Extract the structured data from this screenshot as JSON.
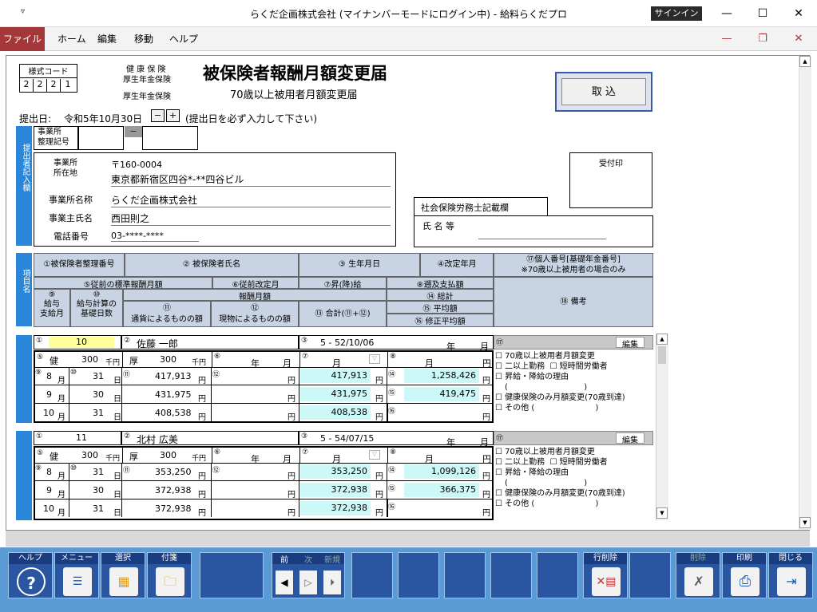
{
  "window": {
    "title": "らくだ企画株式会社 (マイナンバーモードにログイン中) - 給料らくだプロ",
    "signin": "サインイン",
    "min": "—",
    "max": "☐",
    "close": "✕"
  },
  "menu": {
    "file": "ファイル",
    "home": "ホーム",
    "edit": "編集",
    "move": "移動",
    "help": "ヘルプ",
    "mdi_min": "—",
    "mdi_restore": "❐",
    "mdi_close": "✕"
  },
  "form": {
    "code_label": "様式コード",
    "code_digits": [
      "2",
      "2",
      "2",
      "1"
    ],
    "ins1": "健 康 保 険",
    "ins2": "厚生年金保険",
    "ins3": "厚生年金保険",
    "title": "被保険者報酬月額変更届",
    "subtitle": "70歳以上被用者月額変更届",
    "import_btn": "取 込",
    "submit_label": "提出日:",
    "submit_date": "令和5年10月30日",
    "minus": "−",
    "plus": "+",
    "submit_note": "(提出日を必ず入力して下さい)",
    "office_no_label": "事業所\n整理記号",
    "office_no_dash": "−",
    "side_label": "提出者記入欄",
    "addr_label": "事業所\n所在地",
    "postal": "〒160-0004",
    "address": "東京都新宿区四谷*-**四谷ビル",
    "name_label": "事業所名称",
    "company": "らくだ企画株式会社",
    "owner_label": "事業主氏名",
    "owner": "西田則之",
    "tel_label": "電話番号",
    "tel": "03-****-****",
    "stamp_label": "受付印",
    "sharoshi_label": "社会保険労務士記載欄",
    "sharoshi_name_label": "氏 名 等"
  },
  "headers": {
    "side": "項目名",
    "h1": "①被保険者整理番号",
    "h2": "② 被保険者氏名",
    "h3": "③ 生年月日",
    "h4": "④改定年月",
    "h17": "⑰個人番号[基礎年金番号]\n※70歳以上被用者の場合のみ",
    "h5": "⑤従前の標準報酬月額",
    "h6": "⑥従前改定月",
    "h7": "⑦昇(降)給",
    "h8": "⑧遡及支払額",
    "h_pay": "報酬月額",
    "h14": "⑭ 総計",
    "h9": "⑨\n給与\n支給月",
    "h10": "⑩\n給与計算の\n基礎日数",
    "h11": "⑪\n通貨によるものの額",
    "h12": "⑫\n現物によるものの額",
    "h13": "⑬ 合計(⑪+⑫)",
    "h15": "⑮ 平均額",
    "h16": "⑯ 修正平均額",
    "h18": "⑱ 備考"
  },
  "records": [
    {
      "no": "10",
      "name": "佐藤 一郎",
      "birth": "5 - 52/10/06",
      "nen": "年",
      "tsuki": "月",
      "ken": "健",
      "ken_v": "300",
      "kou": "厚",
      "kou_v": "300",
      "sen": "千円",
      "c6_nen": "年",
      "c6_tsuki": "月",
      "c7_tsuki": "月",
      "c8_tsuki": "月",
      "en": "円",
      "rows": [
        {
          "m": "8",
          "d": "31",
          "v11": "417,913",
          "v13": "417,913"
        },
        {
          "m": "9",
          "d": "30",
          "v11": "431,975",
          "v13": "431,975"
        },
        {
          "m": "10",
          "d": "31",
          "v11": "408,538",
          "v13": "408,538"
        }
      ],
      "total": "1,258,426",
      "avg": "419,475",
      "edit": "編集",
      "checks": [
        "70歳以上被用者月額変更",
        "二以上勤務",
        "短時間労働者",
        "昇給・降給の理由",
        "(                              )",
        "健康保険のみ月額変更(70歳到達)",
        "その他 (                        )"
      ]
    },
    {
      "no": "11",
      "name": "北村 広美",
      "birth": "5 - 54/07/15",
      "nen": "年",
      "tsuki": "月",
      "ken": "健",
      "ken_v": "300",
      "kou": "厚",
      "kou_v": "300",
      "sen": "千円",
      "c6_nen": "年",
      "c6_tsuki": "月",
      "c7_tsuki": "月",
      "c8_tsuki": "月",
      "en": "円",
      "rows": [
        {
          "m": "8",
          "d": "31",
          "v11": "353,250",
          "v13": "353,250"
        },
        {
          "m": "9",
          "d": "30",
          "v11": "372,938",
          "v13": "372,938"
        },
        {
          "m": "10",
          "d": "31",
          "v11": "372,938",
          "v13": "372,938"
        }
      ],
      "total": "1,099,126",
      "avg": "366,375",
      "edit": "編集",
      "checks": [
        "70歳以上被用者月額変更",
        "二以上勤務",
        "短時間労働者",
        "昇給・降給の理由",
        "(                              )",
        "健康保険のみ月額変更(70歳到達)",
        "その他 (                        )"
      ]
    }
  ],
  "unit_labels": {
    "gatsu": "月",
    "nichi": "日",
    "en": "円"
  },
  "toolbar": {
    "help": "ヘルプ",
    "menu": "メニュー",
    "select": "選択",
    "tag": "付箋",
    "prev": "前",
    "next": "次",
    "new": "新規",
    "delrow": "行削除",
    "delete": "削除",
    "print": "印刷",
    "close": "閉じる"
  }
}
